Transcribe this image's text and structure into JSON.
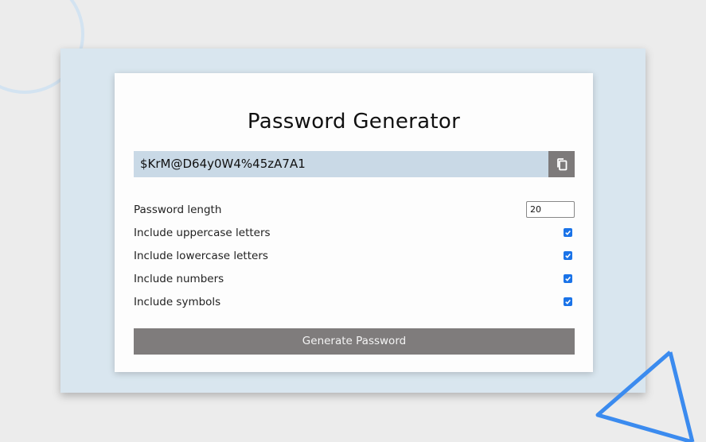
{
  "app": {
    "title": "Password Generator"
  },
  "password": {
    "value": "$KrM@D64y0W4%45zA7A1"
  },
  "copy_button": {
    "icon": "copy-icon"
  },
  "settings": {
    "length_label": "Password length",
    "length_value": "20",
    "uppercase_label": "Include uppercase letters",
    "uppercase_checked": true,
    "lowercase_label": "Include lowercase letters",
    "lowercase_checked": true,
    "numbers_label": "Include numbers",
    "numbers_checked": true,
    "symbols_label": "Include symbols",
    "symbols_checked": true
  },
  "generate_button": {
    "label": "Generate Password"
  },
  "colors": {
    "page_bg": "#ececec",
    "outer_panel": "#d9e6ef",
    "card_bg": "#fdfdfd",
    "password_field": "#c9d9e6",
    "button_gray": "#7f7c7c",
    "checkbox_blue": "#1a73e8",
    "deco_triangle": "#3b8bef",
    "deco_circle": "#d3e3f1"
  }
}
